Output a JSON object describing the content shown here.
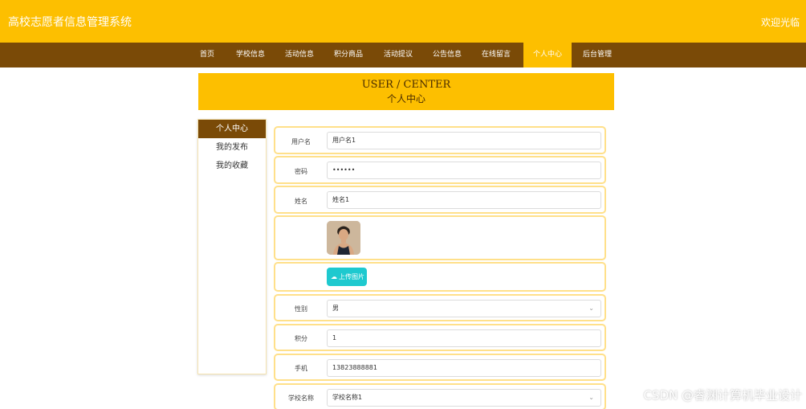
{
  "header": {
    "site_title": "高校志愿者信息管理系统",
    "welcome": "欢迎光临"
  },
  "nav": {
    "items": [
      {
        "label": "首页"
      },
      {
        "label": "学校信息"
      },
      {
        "label": "活动信息"
      },
      {
        "label": "积分商品"
      },
      {
        "label": "活动提议"
      },
      {
        "label": "公告信息"
      },
      {
        "label": "在线留言"
      },
      {
        "label": "个人中心",
        "active": true
      },
      {
        "label": "后台管理"
      }
    ]
  },
  "banner": {
    "en": "USER / CENTER",
    "cn": "个人中心"
  },
  "sidebar": {
    "items": [
      {
        "label": "个人中心",
        "active": true
      },
      {
        "label": "我的发布"
      },
      {
        "label": "我的收藏"
      }
    ]
  },
  "form": {
    "username": {
      "label": "用户名",
      "value": "用户名1"
    },
    "password": {
      "label": "密码",
      "value": "••••••"
    },
    "name": {
      "label": "姓名",
      "value": "姓名1"
    },
    "upload_label": "上传图片",
    "gender": {
      "label": "性别",
      "value": "男"
    },
    "points": {
      "label": "积分",
      "value": "1"
    },
    "phone": {
      "label": "手机",
      "value": "13823888881"
    },
    "school": {
      "label": "学校名称",
      "value": "学校名称1"
    }
  },
  "watermark": "CSDN @睿渊计算机毕业设计",
  "colors": {
    "primary": "#fdbf00",
    "nav_bg": "#7a4a07",
    "upload_btn": "#1ec9cf",
    "row_border": "#ffe08a"
  }
}
